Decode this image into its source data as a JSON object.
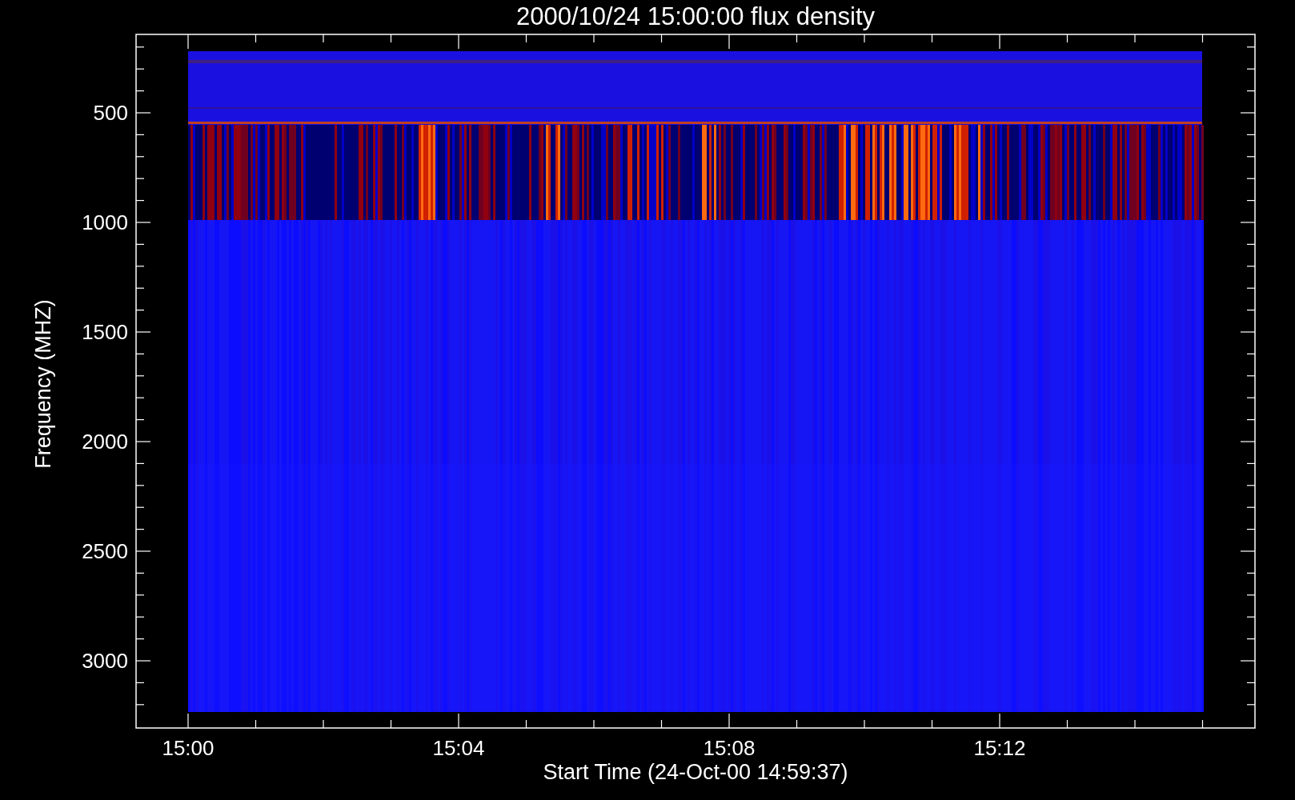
{
  "plot": {
    "title": "2000/10/24 15:00:00 flux density",
    "xlabel": "Start Time (24-Oct-00 14:59:37)",
    "ylabel": "Frequency (MHZ)",
    "xticks": [
      "15:00",
      "15:04",
      "15:08",
      "15:12"
    ],
    "yticks": [
      "500",
      "1000",
      "1500",
      "2000",
      "2500",
      "3000"
    ]
  }
}
